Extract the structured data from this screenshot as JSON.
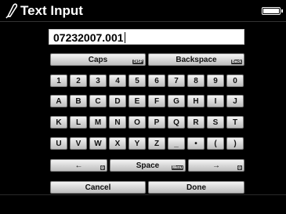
{
  "title": "Text Input",
  "icons": {
    "title": "pencil-icon",
    "status": "battery-icon",
    "left": "arrow-left-icon",
    "right": "arrow-right-icon"
  },
  "input": {
    "value": "07232007.001"
  },
  "keys": {
    "caps": "Caps",
    "caps_hint": "DISP",
    "backspace": "Backspace",
    "backspace_hint": "Back",
    "row1": [
      "1",
      "2",
      "3",
      "4",
      "5",
      "6",
      "7",
      "8",
      "9",
      "0"
    ],
    "row2": [
      "A",
      "B",
      "C",
      "D",
      "E",
      "F",
      "G",
      "H",
      "I",
      "J"
    ],
    "row3": [
      "K",
      "L",
      "M",
      "N",
      "O",
      "P",
      "Q",
      "R",
      "S",
      "T"
    ],
    "row4": [
      "U",
      "V",
      "W",
      "X",
      "Y",
      "Z",
      "_",
      "•",
      "(",
      ")"
    ],
    "left": "←",
    "left_hint": "◎",
    "space": "Space",
    "space_hint": "Menu",
    "right": "→",
    "right_hint": "◎",
    "cancel": "Cancel",
    "done": "Done"
  },
  "colors": {
    "background": "#000000",
    "key_top": "#f4f4f4",
    "key_bottom": "#bdbdbd",
    "text": "#111111"
  }
}
